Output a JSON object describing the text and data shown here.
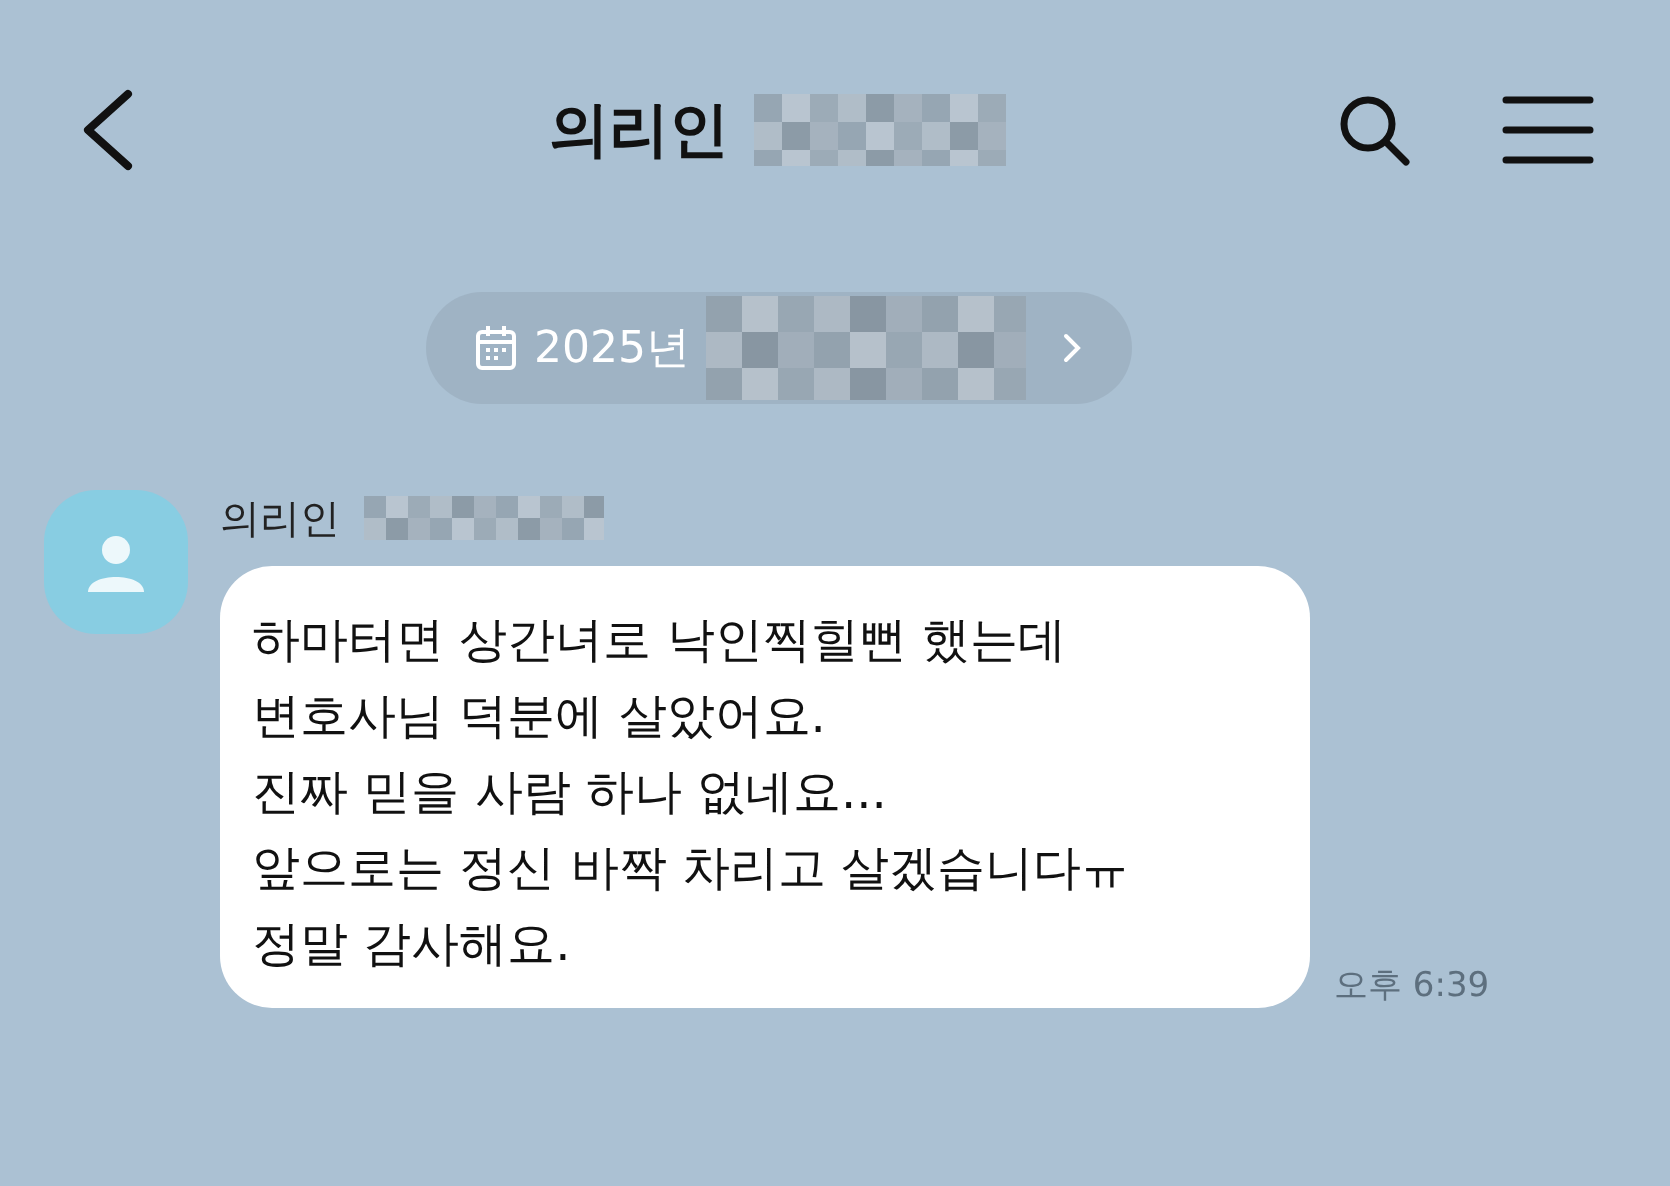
{
  "header": {
    "title": "의리인"
  },
  "date_pill": {
    "label": "2025년"
  },
  "message": {
    "sender": "의리인",
    "text": "하마터면 상간녀로 낙인찍힐뻔 했는데\n변호사님 덕분에 살았어요.\n진짜 믿을 사람 하나 없네요...\n앞으로는 정신 바짝 차리고 살겠습니다ㅠ\n정말 감사해요.",
    "time": "오후 6:39"
  }
}
